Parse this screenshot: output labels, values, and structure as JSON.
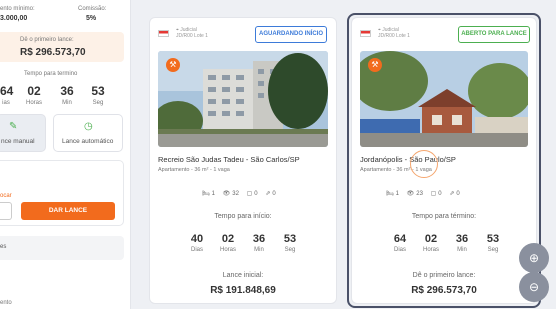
{
  "left": {
    "min_inc_label": "ento mínimo:",
    "min_inc_value": "3.000,00",
    "commission_label": "Comissão:",
    "commission_value": "5%",
    "first_bid_label": "Dê o primeiro lance:",
    "first_bid_value": "R$ 296.573,70",
    "time_label": "Tempo para termino",
    "countdown": [
      {
        "n": "64",
        "u": "ias"
      },
      {
        "n": "02",
        "u": "Horas"
      },
      {
        "n": "36",
        "u": "Min"
      },
      {
        "n": "53",
        "u": "Seg"
      }
    ],
    "mode_manual": "nce manual",
    "mode_auto": "Lance automático",
    "or_label": "ocar",
    "bid_button": "DAR LANCE",
    "section_label": "es",
    "bottom_label": "ento"
  },
  "cards": [
    {
      "loc1": "Judicial",
      "loc2": "JD/R00 Lote 1",
      "status": "AGUARDANDO INÍCIO",
      "title": "Recreio São Judas Tadeu - São Carlos/SP",
      "sub": "Apartamento - 36 m² - 1 vaga",
      "feats": [
        "1",
        "32",
        "0",
        "0"
      ],
      "time_label": "Tempo para início:",
      "countdown": [
        {
          "n": "40",
          "u": "Dias"
        },
        {
          "n": "02",
          "u": "Horas"
        },
        {
          "n": "36",
          "u": "Min"
        },
        {
          "n": "53",
          "u": "Seg"
        }
      ],
      "price_label": "Lance inicial:",
      "price": "R$ 191.848,69"
    },
    {
      "loc1": "Judicial",
      "loc2": "JD/R00 Lote 1",
      "status": "ABERTO PARA LANCE",
      "title": "Jordanópolis - São Paulo/SP",
      "sub": "Apartamento - 36 m² - 1 vaga",
      "feats": [
        "1",
        "23",
        "0",
        "0"
      ],
      "time_label": "Tempo para término:",
      "countdown": [
        {
          "n": "64",
          "u": "Dias"
        },
        {
          "n": "02",
          "u": "Horas"
        },
        {
          "n": "36",
          "u": "Min"
        },
        {
          "n": "53",
          "u": "Seg"
        }
      ],
      "price_label": "Dê o primeiro lance:",
      "price": "R$ 296.573,70"
    }
  ],
  "colors": {
    "accent": "#f26b1d",
    "wait": "#3d7bd9",
    "open": "#4caf50"
  }
}
